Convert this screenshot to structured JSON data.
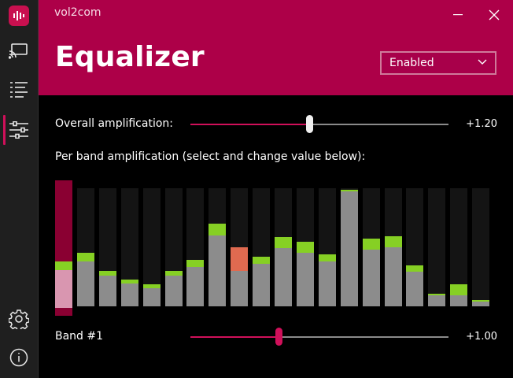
{
  "app": {
    "title": "vol2com"
  },
  "header": {
    "title": "Equalizer"
  },
  "mode_dropdown": {
    "selected": "Enabled"
  },
  "overall": {
    "label": "Overall amplification:",
    "value_text": "+1.20",
    "fraction": 0.46
  },
  "bands_section": {
    "label": "Per band amplification (select and change value below):"
  },
  "bands": [
    {
      "level": 0.32,
      "peak": 0.07,
      "selected": true
    },
    {
      "level": 0.38,
      "peak": 0.07
    },
    {
      "level": 0.26,
      "peak": 0.04
    },
    {
      "level": 0.19,
      "peak": 0.03
    },
    {
      "level": 0.15,
      "peak": 0.03
    },
    {
      "level": 0.26,
      "peak": 0.04
    },
    {
      "level": 0.33,
      "peak": 0.06
    },
    {
      "level": 0.6,
      "peak": 0.1
    },
    {
      "level": 0.3,
      "peak": 0.2,
      "peak_color": "#e06a50"
    },
    {
      "level": 0.36,
      "peak": 0.06
    },
    {
      "level": 0.49,
      "peak": 0.09
    },
    {
      "level": 0.45,
      "peak": 0.09
    },
    {
      "level": 0.38,
      "peak": 0.06
    },
    {
      "level": 0.97,
      "peak": 0.01
    },
    {
      "level": 0.48,
      "peak": 0.09
    },
    {
      "level": 0.5,
      "peak": 0.09
    },
    {
      "level": 0.29,
      "peak": 0.05
    },
    {
      "level": 0.09,
      "peak": 0.01
    },
    {
      "level": 0.09,
      "peak": 0.09
    },
    {
      "level": 0.04,
      "peak": 0.01
    }
  ],
  "band_control": {
    "label": "Band #1",
    "value_text": "+1.00",
    "fraction": 0.34
  },
  "colors": {
    "accent": "#d0105a",
    "header": "#ad0048",
    "level": "#8c8c8c",
    "peak": "#86d024",
    "selected_bg": "#8a0032",
    "selected_level": "#d996b0"
  },
  "icons": [
    "logo-icon",
    "cast-icon",
    "list-icon",
    "equalizer-icon",
    "settings-icon",
    "info-icon",
    "minimize-icon",
    "close-icon",
    "chevron-down-icon"
  ]
}
